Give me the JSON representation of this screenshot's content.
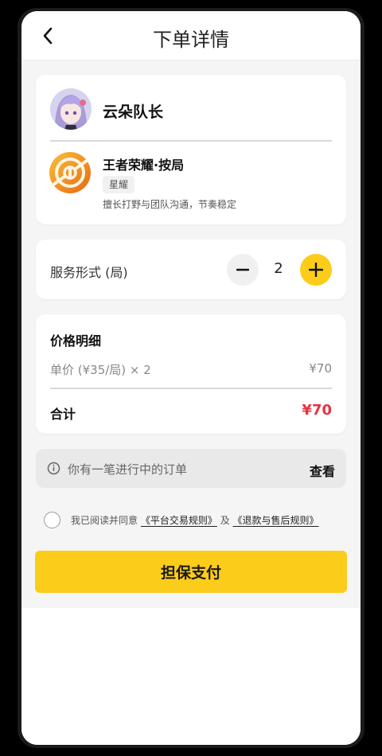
{
  "header": {
    "title": "下单详情"
  },
  "provider": {
    "name": "云朵队长",
    "game_title": "王者荣耀·按局",
    "rank_badge": "星耀",
    "description": "擅长打野与团队沟通，节奏稳定"
  },
  "service": {
    "label": "服务形式 (局)",
    "quantity": "2",
    "minus_icon": "minus-icon",
    "plus_icon": "plus-icon"
  },
  "price": {
    "title": "价格明细",
    "unit_label": "单价 (¥35/局) × 2",
    "unit_value": "¥70",
    "total_label": "合计",
    "total_value": "¥70"
  },
  "notice": {
    "text": "你有一笔进行中的订单",
    "link": "查看"
  },
  "agreement": {
    "prefix": "我已阅读并同意",
    "rule1": "《平台交易规则》",
    "joiner": "及",
    "rule2": "《退款与售后规则》"
  },
  "pay_button": {
    "label": "担保支付"
  },
  "colors": {
    "accent": "#fccc1b",
    "total_red": "#e8323f",
    "background": "#f5f5f5"
  }
}
